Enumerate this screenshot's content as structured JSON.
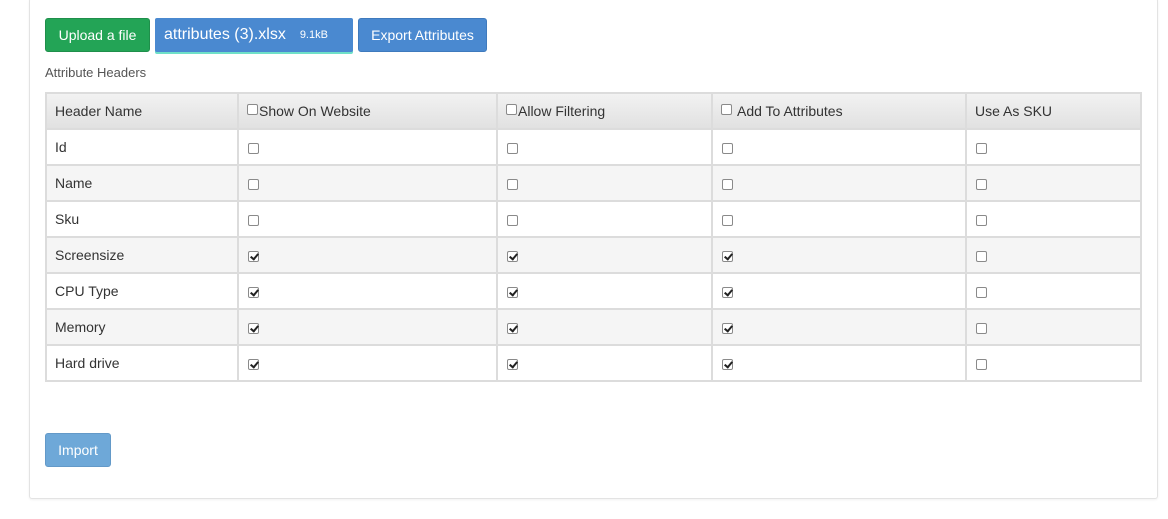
{
  "toolbar": {
    "upload_label": "Upload a file",
    "file_name": "attributes (3).xlsx",
    "file_size": "9.1kB",
    "export_label": "Export Attributes"
  },
  "section_label": "Attribute Headers",
  "table": {
    "columns": [
      "Header Name",
      "Show On Website",
      "Allow Filtering",
      "Add To Attributes",
      "Use As SKU"
    ],
    "header_checkboxes": [
      false,
      false,
      false
    ],
    "rows": [
      {
        "name": "Id",
        "show": false,
        "filter": false,
        "attr": false,
        "sku": false
      },
      {
        "name": "Name",
        "show": false,
        "filter": false,
        "attr": false,
        "sku": false
      },
      {
        "name": "Sku",
        "show": false,
        "filter": false,
        "attr": false,
        "sku": false
      },
      {
        "name": "Screensize",
        "show": true,
        "filter": true,
        "attr": true,
        "sku": false
      },
      {
        "name": "CPU Type",
        "show": true,
        "filter": true,
        "attr": true,
        "sku": false
      },
      {
        "name": "Memory",
        "show": true,
        "filter": true,
        "attr": true,
        "sku": false
      },
      {
        "name": "Hard drive",
        "show": true,
        "filter": true,
        "attr": true,
        "sku": false
      }
    ]
  },
  "import_label": "Import",
  "colors": {
    "upload_button": "#23a456",
    "primary_button": "#4a89d0",
    "import_button": "#6ea8d8"
  }
}
